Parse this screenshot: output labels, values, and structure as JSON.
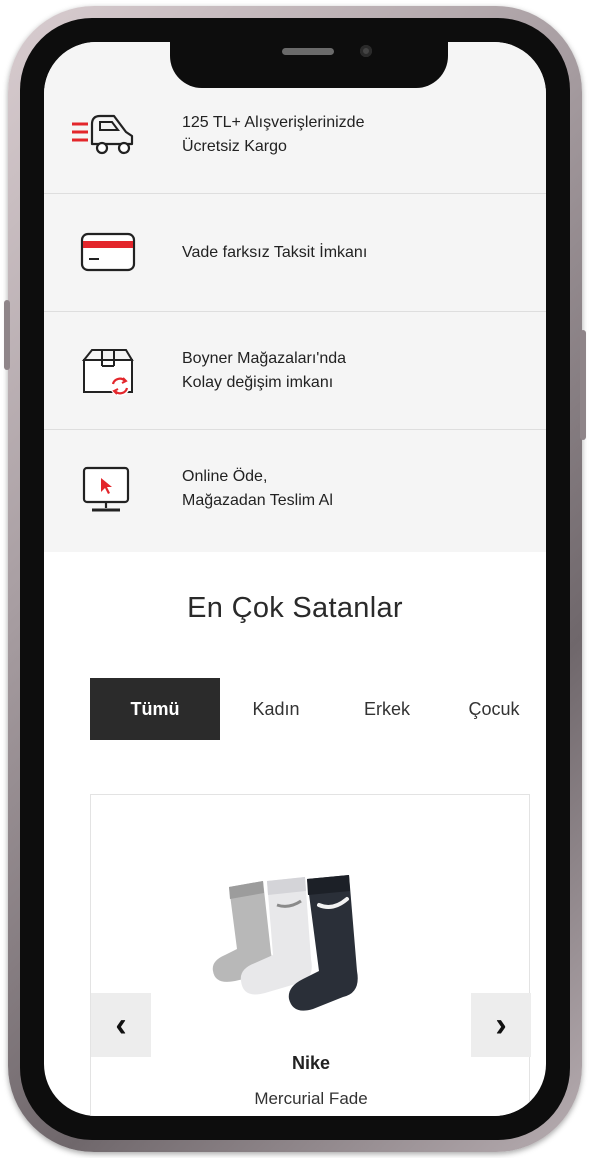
{
  "features": [
    {
      "icon": "delivery-truck-icon",
      "line1": "125 TL+ Alışverişlerinizde",
      "line2": "Ücretsiz Kargo"
    },
    {
      "icon": "credit-card-icon",
      "line1": "Vade farksız Taksit İmkanı",
      "line2": ""
    },
    {
      "icon": "box-exchange-icon",
      "line1": "Boyner Mağazaları'nda",
      "line2": "Kolay değişim imkanı"
    },
    {
      "icon": "monitor-cursor-icon",
      "line1": "Online Öde,",
      "line2": "Mağazadan Teslim Al"
    }
  ],
  "bestsellers": {
    "title": "En Çok Satanlar",
    "tabs": [
      "Tümü",
      "Kadın",
      "Erkek",
      "Çocuk"
    ],
    "active_tab": "Tümü"
  },
  "product": {
    "brand": "Nike",
    "name": "Mercurial Fade",
    "image": "socks-product-image",
    "prev_icon": "chevron-left-icon",
    "next_icon": "chevron-right-icon",
    "prev_glyph": "‹",
    "next_glyph": "›"
  },
  "colors": {
    "accent": "#e3262b",
    "dark": "#2b2b2b",
    "panel": "#f5f5f5"
  }
}
